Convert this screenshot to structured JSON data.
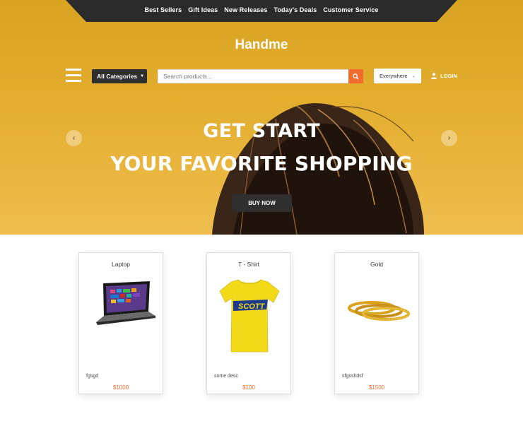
{
  "topnav": {
    "links": [
      "Best Sellers",
      "Gift Ideas",
      "New Releases",
      "Today's Deals",
      "Customer Service"
    ]
  },
  "brand": "Handme",
  "header": {
    "category_label": "All Categories",
    "search_placeholder": "Search products...",
    "location_label": "Everywhere",
    "login_label": "LOGIN"
  },
  "hero": {
    "line1": "GET START",
    "line2": "YOUR FAVORITE SHOPPING",
    "cta": "BUY NOW"
  },
  "products": [
    {
      "name": "Laptop",
      "desc": "fgsgd",
      "price": "$1000"
    },
    {
      "name": "T - Shirt",
      "desc": "some desc",
      "price": "$100"
    },
    {
      "name": "Gold",
      "desc": "sfgsshdsf",
      "price": "$1500"
    }
  ],
  "colors": {
    "accent": "#f26a2c",
    "hero_bg": "#e3ae2f",
    "dark": "#2f2f2f"
  },
  "icons": [
    "menu-icon",
    "search-icon",
    "user-icon",
    "chevron-left-icon",
    "chevron-right-icon"
  ]
}
